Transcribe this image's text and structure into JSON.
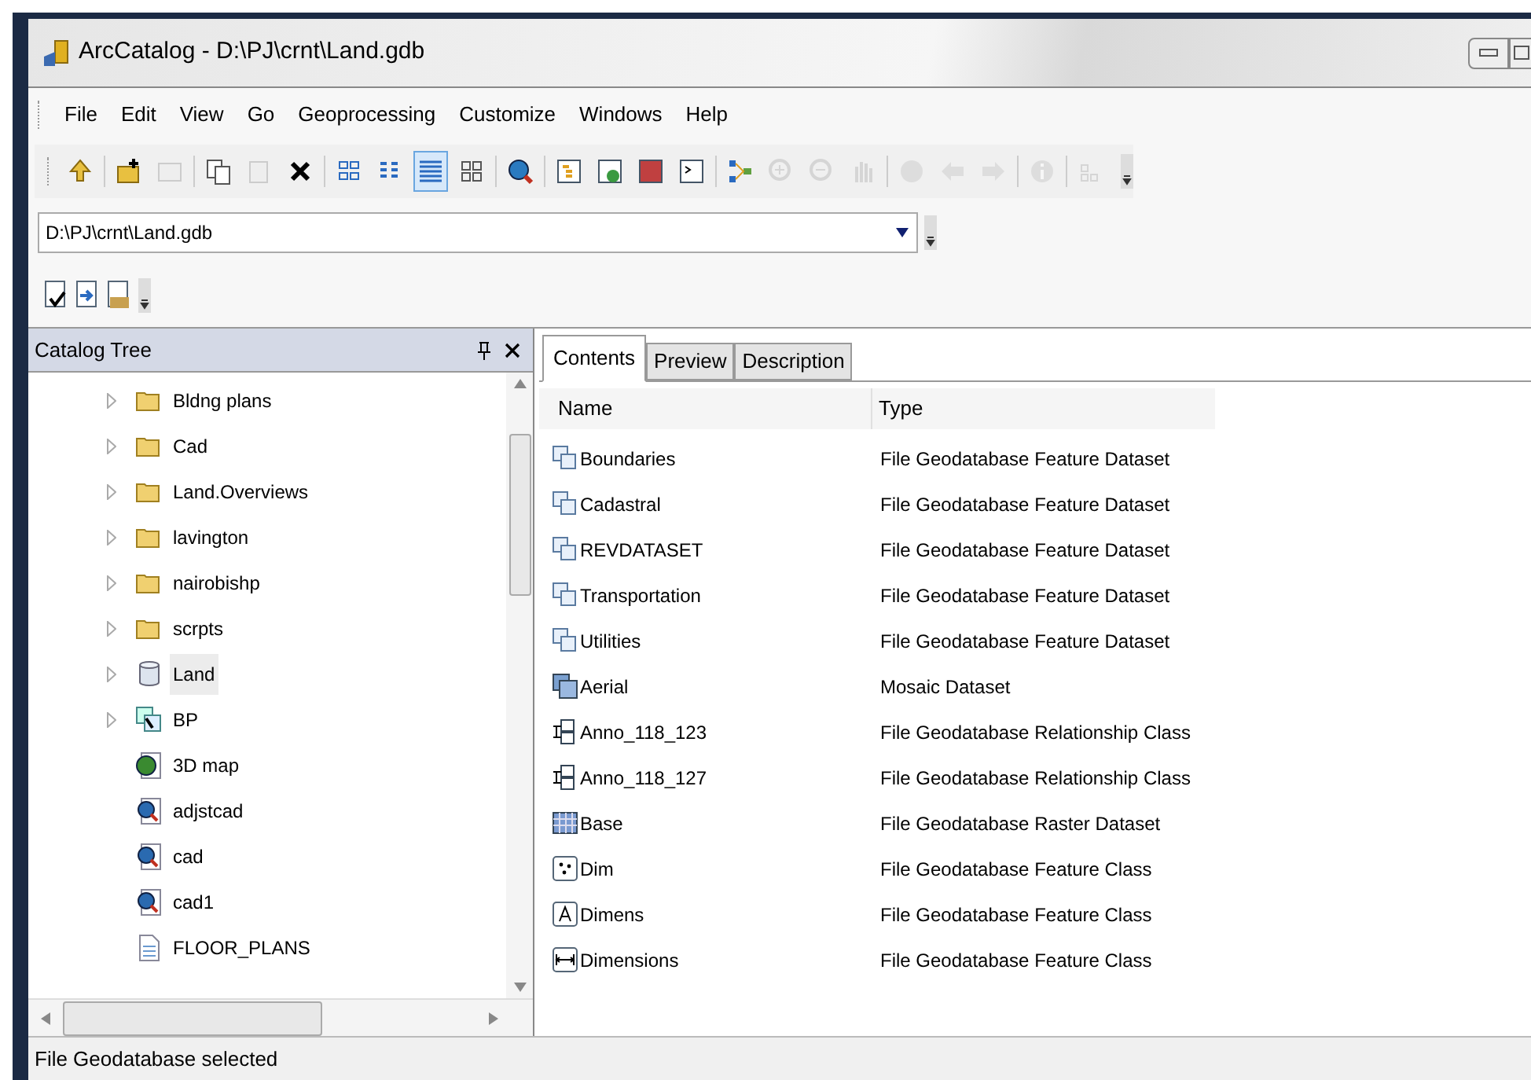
{
  "window": {
    "title": "ArcCatalog - D:\\PJ\\crnt\\Land.gdb"
  },
  "menu": [
    "File",
    "Edit",
    "View",
    "Go",
    "Geoprocessing",
    "Customize",
    "Windows",
    "Help"
  ],
  "toolbar": {
    "buttons": [
      {
        "disabled": false,
        "selected": false
      },
      {
        "disabled": false,
        "selected": false
      },
      {
        "disabled": true,
        "selected": false
      },
      {
        "disabled": false,
        "selected": false
      },
      {
        "disabled": true,
        "selected": false
      },
      {
        "disabled": false,
        "selected": false
      },
      {
        "disabled": false,
        "selected": false
      },
      {
        "disabled": false,
        "selected": false
      },
      {
        "disabled": false,
        "selected": true
      },
      {
        "disabled": false,
        "selected": false
      },
      {
        "disabled": false,
        "selected": false
      },
      {
        "disabled": false,
        "selected": false
      },
      {
        "disabled": false,
        "selected": false
      },
      {
        "disabled": false,
        "selected": false
      },
      {
        "disabled": false,
        "selected": false
      },
      {
        "disabled": false,
        "selected": false
      },
      {
        "disabled": true,
        "selected": false
      },
      {
        "disabled": true,
        "selected": false
      },
      {
        "disabled": true,
        "selected": false
      },
      {
        "disabled": true,
        "selected": false
      },
      {
        "disabled": true,
        "selected": false
      },
      {
        "disabled": true,
        "selected": false
      },
      {
        "disabled": true,
        "selected": false
      },
      {
        "disabled": true,
        "selected": false
      }
    ]
  },
  "location": {
    "value": "D:\\PJ\\crnt\\Land.gdb"
  },
  "catalog_tree": {
    "title": "Catalog Tree",
    "items": [
      {
        "label": "Bldng plans",
        "kind": "folder",
        "expandable": true,
        "selected": false
      },
      {
        "label": "Cad",
        "kind": "folder",
        "expandable": true,
        "selected": false
      },
      {
        "label": "Land.Overviews",
        "kind": "folder",
        "expandable": true,
        "selected": false
      },
      {
        "label": "lavington",
        "kind": "folder",
        "expandable": true,
        "selected": false
      },
      {
        "label": "nairobishp",
        "kind": "folder",
        "expandable": true,
        "selected": false
      },
      {
        "label": "scrpts",
        "kind": "folder",
        "expandable": true,
        "selected": false
      },
      {
        "label": "Land",
        "kind": "database",
        "expandable": true,
        "selected": true
      },
      {
        "label": "BP",
        "kind": "toolbox",
        "expandable": true,
        "selected": false
      },
      {
        "label": "3D map",
        "kind": "globe",
        "expandable": false,
        "selected": false
      },
      {
        "label": "adjstcad",
        "kind": "map",
        "expandable": false,
        "selected": false
      },
      {
        "label": "cad",
        "kind": "map",
        "expandable": false,
        "selected": false
      },
      {
        "label": "cad1",
        "kind": "map",
        "expandable": false,
        "selected": false
      },
      {
        "label": "FLOOR_PLANS",
        "kind": "document",
        "expandable": false,
        "selected": false
      }
    ]
  },
  "tabs": [
    {
      "label": "Contents",
      "selected": true
    },
    {
      "label": "Preview",
      "selected": false
    },
    {
      "label": "Description",
      "selected": false
    }
  ],
  "table": {
    "columns": [
      "Name",
      "Type"
    ],
    "rows": [
      {
        "name": "Boundaries",
        "type": "File Geodatabase Feature Dataset",
        "kind": "dataset"
      },
      {
        "name": "Cadastral",
        "type": "File Geodatabase Feature Dataset",
        "kind": "dataset"
      },
      {
        "name": "REVDATASET",
        "type": "File Geodatabase Feature Dataset",
        "kind": "dataset"
      },
      {
        "name": "Transportation",
        "type": "File Geodatabase Feature Dataset",
        "kind": "dataset"
      },
      {
        "name": "Utilities",
        "type": "File Geodatabase Feature Dataset",
        "kind": "dataset"
      },
      {
        "name": "Aerial",
        "type": "Mosaic Dataset",
        "kind": "mosaic"
      },
      {
        "name": "Anno_118_123",
        "type": "File Geodatabase Relationship Class",
        "kind": "relationship"
      },
      {
        "name": "Anno_118_127",
        "type": "File Geodatabase Relationship Class",
        "kind": "relationship"
      },
      {
        "name": "Base",
        "type": "File Geodatabase Raster Dataset",
        "kind": "raster"
      },
      {
        "name": "Dim",
        "type": "File Geodatabase Feature Class",
        "kind": "point"
      },
      {
        "name": "Dimens",
        "type": "File Geodatabase Feature Class",
        "kind": "annotation"
      },
      {
        "name": "Dimensions",
        "type": "File Geodatabase Feature Class",
        "kind": "dimension"
      }
    ]
  },
  "status_bar": "File Geodatabase selected"
}
